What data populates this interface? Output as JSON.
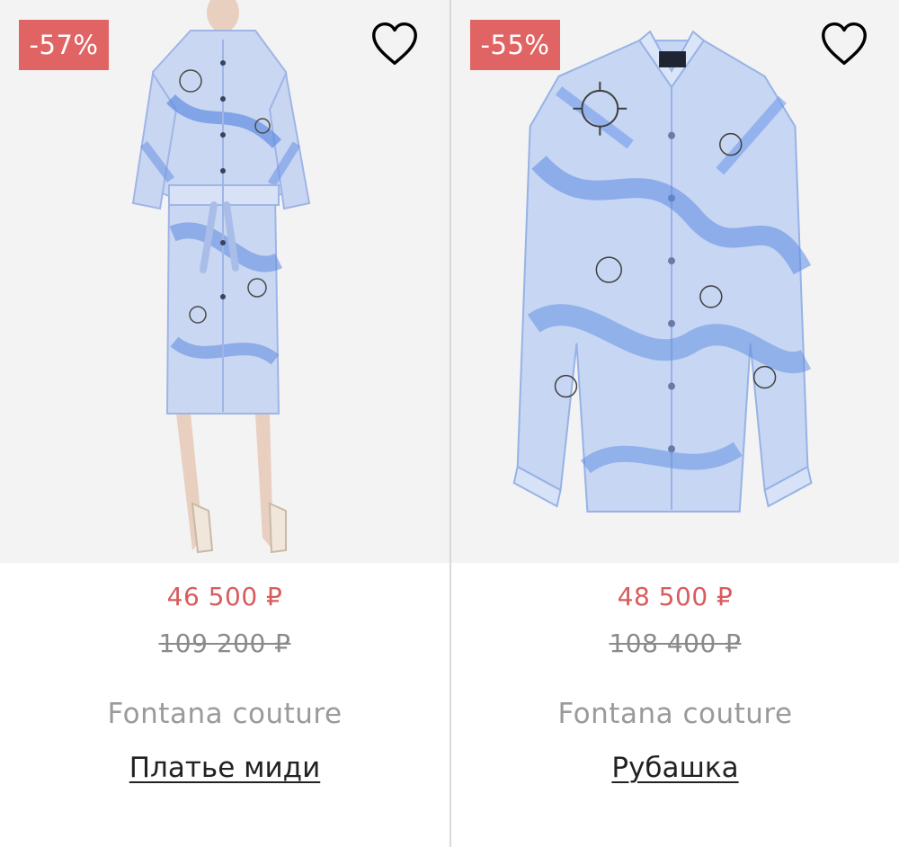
{
  "colors": {
    "badge_bg": "#e16464",
    "sale_price": "#d85c5c",
    "old_price": "#8a8a8a",
    "brand_text": "#9a9a9a",
    "image_bg": "#f3f3f3"
  },
  "products": [
    {
      "discount": "-57%",
      "favorite_icon": "heart-outline-icon",
      "image": "blue-printed-shirt-dress",
      "price": "46 500 ₽",
      "old_price": "109 200 ₽",
      "brand": "Fontana couture",
      "title": "Платье миди"
    },
    {
      "discount": "-55%",
      "favorite_icon": "heart-outline-icon",
      "image": "blue-printed-silk-shirt",
      "price": "48 500 ₽",
      "old_price": "108 400 ₽",
      "brand": "Fontana couture",
      "title": "Рубашка"
    }
  ]
}
